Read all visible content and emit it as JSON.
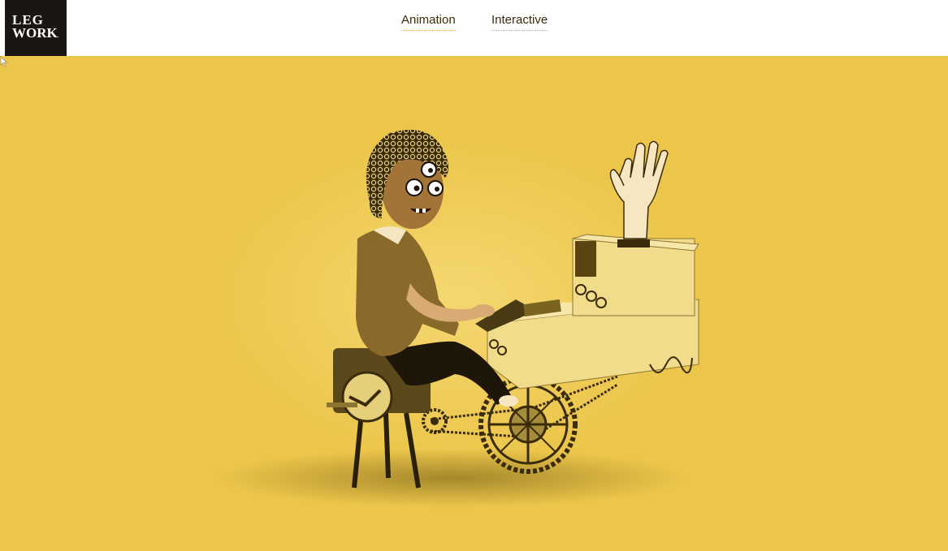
{
  "logo": {
    "line1": "LEG",
    "line2": "WORK",
    "mark": "."
  },
  "nav": {
    "items": [
      {
        "label": "Animation"
      },
      {
        "label": "Interactive"
      }
    ]
  },
  "hero": {
    "background_color": "#ecc64b",
    "illustration": "character-typing-on-bicycle-machine"
  }
}
